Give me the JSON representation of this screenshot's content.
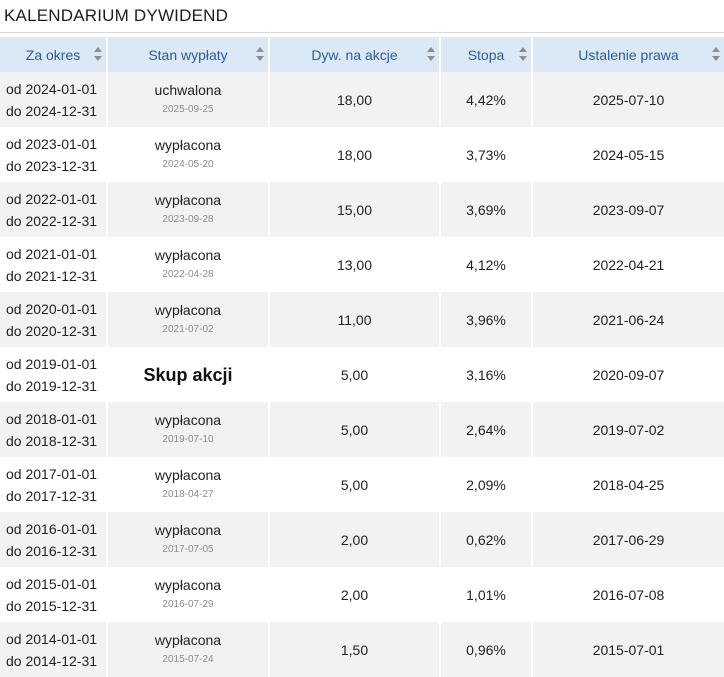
{
  "title": "KALENDARIUM DYWIDEND",
  "columns": [
    "Za okres",
    "Stan wypłaty",
    "Dyw. na akcje",
    "Stopa",
    "Ustalenie prawa"
  ],
  "rows": [
    {
      "from": "od 2024-01-01",
      "to": "do 2024-12-31",
      "status": "uchwalona",
      "status_date": "2025-09-25",
      "special": false,
      "dividend": "18,00",
      "rate": "4,42%",
      "record_date": "2025-07-10"
    },
    {
      "from": "od 2023-01-01",
      "to": "do 2023-12-31",
      "status": "wypłacona",
      "status_date": "2024-05-20",
      "special": false,
      "dividend": "18,00",
      "rate": "3,73%",
      "record_date": "2024-05-15"
    },
    {
      "from": "od 2022-01-01",
      "to": "do 2022-12-31",
      "status": "wypłacona",
      "status_date": "2023-09-28",
      "special": false,
      "dividend": "15,00",
      "rate": "3,69%",
      "record_date": "2023-09-07"
    },
    {
      "from": "od 2021-01-01",
      "to": "do 2021-12-31",
      "status": "wypłacona",
      "status_date": "2022-04-28",
      "special": false,
      "dividend": "13,00",
      "rate": "4,12%",
      "record_date": "2022-04-21"
    },
    {
      "from": "od 2020-01-01",
      "to": "do 2020-12-31",
      "status": "wypłacona",
      "status_date": "2021-07-02",
      "special": false,
      "dividend": "11,00",
      "rate": "3,96%",
      "record_date": "2021-06-24"
    },
    {
      "from": "od 2019-01-01",
      "to": "do 2019-12-31",
      "status": "Skup akcji",
      "status_date": "",
      "special": true,
      "dividend": "5,00",
      "rate": "3,16%",
      "record_date": "2020-09-07"
    },
    {
      "from": "od 2018-01-01",
      "to": "do 2018-12-31",
      "status": "wypłacona",
      "status_date": "2019-07-10",
      "special": false,
      "dividend": "5,00",
      "rate": "2,64%",
      "record_date": "2019-07-02"
    },
    {
      "from": "od 2017-01-01",
      "to": "do 2017-12-31",
      "status": "wypłacona",
      "status_date": "2018-04-27",
      "special": false,
      "dividend": "5,00",
      "rate": "2,09%",
      "record_date": "2018-04-25"
    },
    {
      "from": "od 2016-01-01",
      "to": "do 2016-12-31",
      "status": "wypłacona",
      "status_date": "2017-07-05",
      "special": false,
      "dividend": "2,00",
      "rate": "0,62%",
      "record_date": "2017-06-29"
    },
    {
      "from": "od 2015-01-01",
      "to": "do 2015-12-31",
      "status": "wypłacona",
      "status_date": "2016-07-29",
      "special": false,
      "dividend": "2,00",
      "rate": "1,01%",
      "record_date": "2016-07-08"
    },
    {
      "from": "od 2014-01-01",
      "to": "do 2014-12-31",
      "status": "wypłacona",
      "status_date": "2015-07-24",
      "special": false,
      "dividend": "1,50",
      "rate": "0,96%",
      "record_date": "2015-07-01"
    }
  ]
}
